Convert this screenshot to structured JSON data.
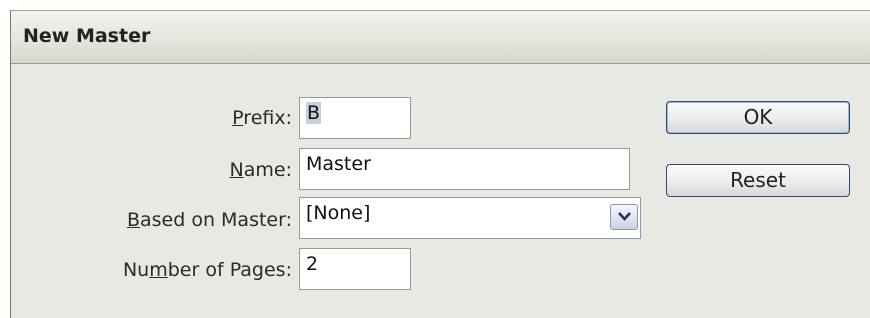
{
  "window": {
    "title": "New Master"
  },
  "form": {
    "prefix": {
      "label_pre": "",
      "label_u": "P",
      "label_post": "refix:",
      "value_selected": "B",
      "value_rest": ""
    },
    "name": {
      "label_pre": "",
      "label_u": "N",
      "label_post": "ame:",
      "value": "Master"
    },
    "based_on": {
      "label_pre": "",
      "label_u": "B",
      "label_post": "ased on Master:",
      "value": "[None]"
    },
    "pages": {
      "label_pre": "Nu",
      "label_u": "m",
      "label_post": "ber of Pages:",
      "value": "2"
    }
  },
  "buttons": {
    "ok": "OK",
    "reset": "Reset"
  },
  "icons": {
    "dropdown": "chevron-down-icon"
  }
}
